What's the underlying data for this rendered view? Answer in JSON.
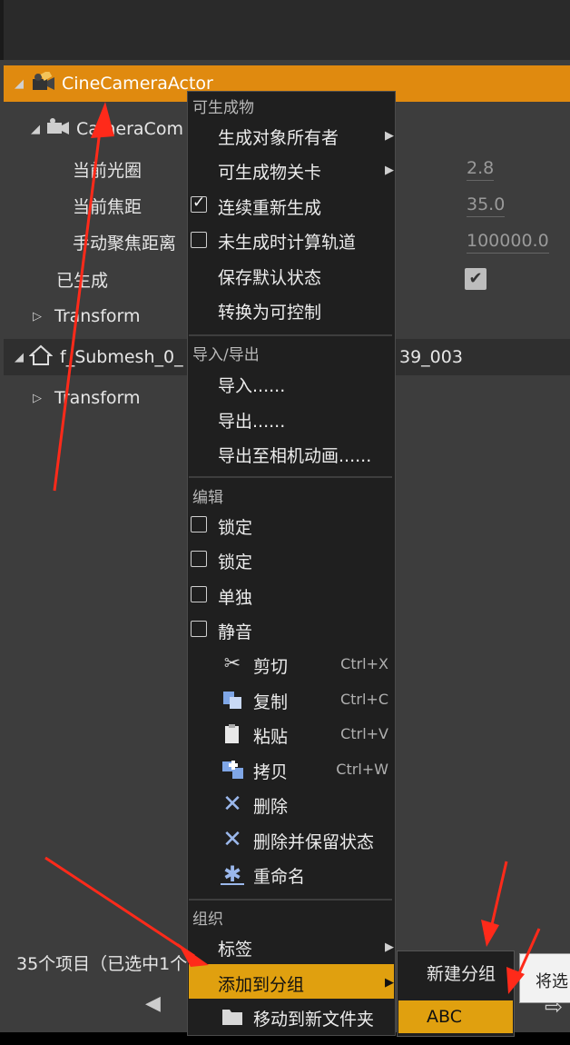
{
  "tree": {
    "actor_name": "CineCameraActor",
    "component_name": "CameraCom",
    "props": [
      {
        "label": "当前光圈",
        "value": "2.8"
      },
      {
        "label": "当前焦距",
        "value": "35.0"
      },
      {
        "label": "手动聚焦距离",
        "value": "100000.0"
      }
    ],
    "generated_label": "已生成",
    "transform_label": "Transform",
    "submesh_name": "f_Submesh_0_",
    "submesh_suffix": "39_003",
    "transform2_label": "Transform"
  },
  "status": {
    "text": "35个项目（已选中1个"
  },
  "menu": {
    "sections": {
      "spawnables": "可生成物",
      "import_export": "导入/导出",
      "edit": "编辑",
      "organize": "组织"
    },
    "items": {
      "spawn_owner": "生成对象所有者",
      "spawn_level": "可生成物关卡",
      "continuous_respawn": "连续重新生成",
      "calc_unspawned_track": "未生成时计算轨道",
      "save_default_state": "保存默认状态",
      "convert_to_possessable": "转换为可控制",
      "import": "导入......",
      "export": "导出......",
      "export_camera_anim": "导出至相机动画......",
      "lock1": "锁定",
      "lock2": "锁定",
      "solo": "单独",
      "mute": "静音",
      "cut": "剪切",
      "copy": "复制",
      "paste": "粘贴",
      "duplicate": "拷贝",
      "delete": "删除",
      "delete_keep_state": "删除并保留状态",
      "rename": "重命名",
      "tags": "标签",
      "add_to_group": "添加到分组",
      "move_to_folder": "移动到新文件夹"
    },
    "shortcuts": {
      "cut": "Ctrl+X",
      "copy": "Ctrl+C",
      "paste": "Ctrl+V",
      "duplicate": "Ctrl+W"
    }
  },
  "submenu": {
    "new_group": "新建分组",
    "abc": "ABC"
  },
  "tooltip": {
    "text": "将选"
  },
  "colors": {
    "selection": "#e08a0f",
    "menu_highlight": "#e0a00f",
    "annotation_arrow": "#ff2a1a"
  }
}
